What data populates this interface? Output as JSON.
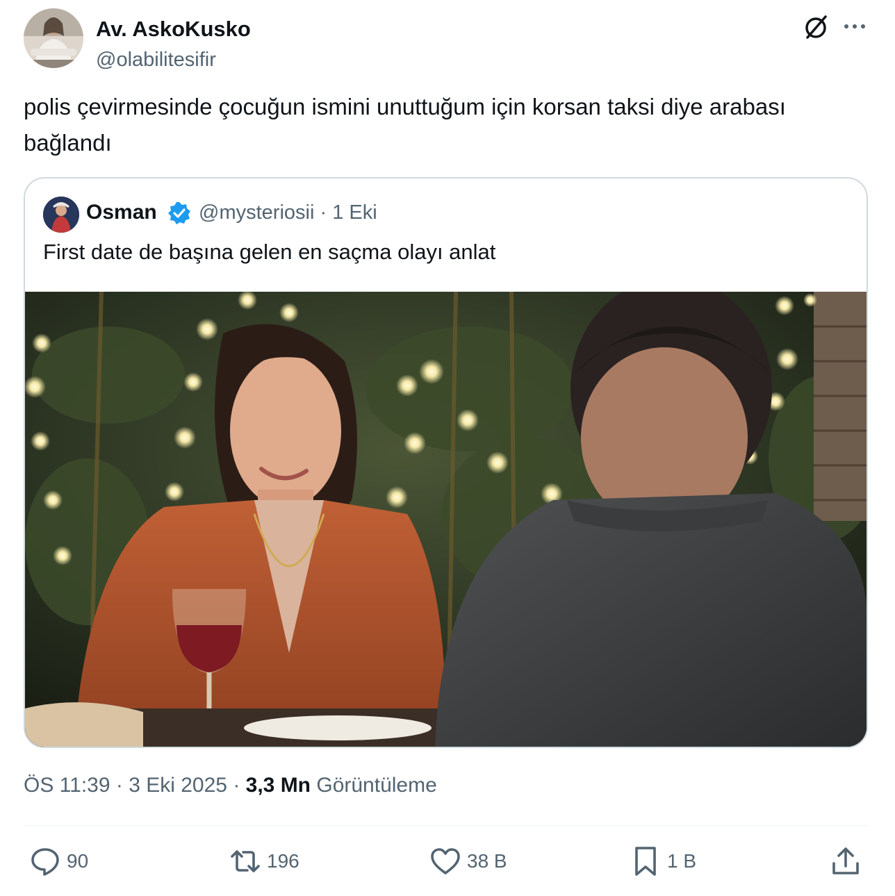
{
  "author": {
    "name": "Av. AskoKusko",
    "handle": "@olabilitesifir",
    "avatar_icon": "profile-photo"
  },
  "tweet": {
    "text": "polis çevirmesinde çocuğun ismini unuttuğum için korsan taksi diye arabası bağlandı"
  },
  "quote": {
    "name": "Osman",
    "handle": "@mysteriosii",
    "date": "1 Eki",
    "text": "First date de başına gelen en saçma olayı anlat",
    "verified_color": "#1d9bf0"
  },
  "meta": {
    "time": "ÖS 11:39",
    "date": "3 Eki 2025",
    "views": "3,3 Mn",
    "views_label": "Görüntüleme"
  },
  "actions": {
    "replies": "90",
    "reposts": "196",
    "likes": "38 B",
    "bookmarks": "1 B"
  },
  "colors": {
    "text": "#0f1419",
    "secondary": "#536471",
    "border": "#cfd9de"
  }
}
